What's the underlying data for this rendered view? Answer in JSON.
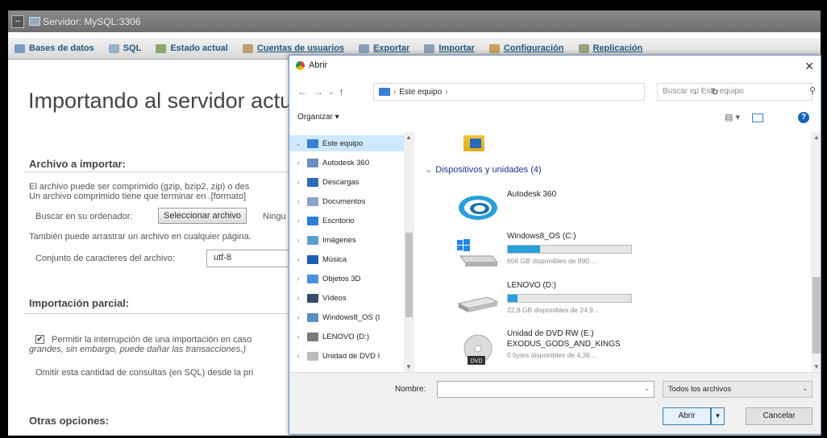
{
  "app": {
    "window_title": "Servidor: MySQL:3306",
    "tabs": [
      {
        "label": "Bases de datos",
        "icon": "databases-icon",
        "color": "#7a9cc4"
      },
      {
        "label": "SQL",
        "icon": "sql-icon",
        "color": "#9ab0c8"
      },
      {
        "label": "Estado actual",
        "icon": "status-icon",
        "color": "#8aa86a"
      },
      {
        "label": "Cuentas de usuarios",
        "icon": "users-icon",
        "color": "#b8a070"
      },
      {
        "label": "Exportar",
        "icon": "export-icon",
        "color": "#8a9fb8"
      },
      {
        "label": "Importar",
        "icon": "import-icon",
        "color": "#8a9fb8"
      },
      {
        "label": "Configuración",
        "icon": "settings-icon",
        "color": "#c7a060"
      },
      {
        "label": "Replicación",
        "icon": "replication-icon",
        "color": "#9aa080"
      }
    ],
    "page_title": "Importando al servidor actua",
    "file_section_title": "Archivo a importar:",
    "compress_line1": "El archivo puede ser comprimido (gzip, bzip2, zip) o des",
    "compress_line2": "Un archivo comprimido tiene que terminar en .[formato]",
    "browse_label": "Buscar en su ordenador:",
    "browse_button": "Seleccionar archivo",
    "no_file": "Ningu",
    "drag_text": "También puede arrastrar un archivo en cualquier página.",
    "charset_label": "Conjunto de caracteres del archivo:",
    "charset_value": "utf-8",
    "partial_title": "Importación parcial:",
    "partial_check": "✔",
    "partial_line1": "Permitir la interrupción de una importación en caso",
    "partial_line2": "grandes, sin embargo, puede dañar las transacciones.)",
    "skip_text": "Omitir esta cantidad de consultas (en SQL) desde la pri",
    "other_title": "Otras opciones:"
  },
  "dialog": {
    "title": "Abrir",
    "close": "✕",
    "nav": {
      "back": "←",
      "forward": "→",
      "recent": "⌄",
      "up": "↑"
    },
    "address": "Este equipo",
    "address_sep": "›",
    "search_placeholder": "Buscar en Este equipo",
    "organize": "Organizar ▾",
    "help": "?",
    "nav_items": [
      {
        "label": "Este equipo",
        "color": "#3a7fd6",
        "chev": "⌄",
        "selected": true,
        "icon": "this-pc-icon"
      },
      {
        "label": "Autodesk 360",
        "color": "#6a8fbf",
        "chev": "›",
        "selected": false,
        "icon": "cloud-icon"
      },
      {
        "label": "Descargas",
        "color": "#2a6bb8",
        "chev": "›",
        "selected": false,
        "icon": "downloads-icon"
      },
      {
        "label": "Documentos",
        "color": "#8aa4c8",
        "chev": "›",
        "selected": false,
        "icon": "documents-icon"
      },
      {
        "label": "Escritorio",
        "color": "#2a7fd6",
        "chev": "›",
        "selected": false,
        "icon": "desktop-icon"
      },
      {
        "label": "Imágenes",
        "color": "#5a9fd0",
        "chev": "›",
        "selected": false,
        "icon": "pictures-icon"
      },
      {
        "label": "Música",
        "color": "#1e5ab0",
        "chev": "›",
        "selected": false,
        "icon": "music-icon"
      },
      {
        "label": "Objetos 3D",
        "color": "#4a90e2",
        "chev": "›",
        "selected": false,
        "icon": "objects3d-icon"
      },
      {
        "label": "Vídeos",
        "color": "#3a4a6a",
        "chev": "›",
        "selected": false,
        "icon": "videos-icon"
      },
      {
        "label": "Windows8_OS (I",
        "color": "#5a8fc0",
        "chev": "›",
        "selected": false,
        "icon": "drive-c-icon"
      },
      {
        "label": "LENOVO (D:)",
        "color": "#7a7a7a",
        "chev": "›",
        "selected": false,
        "icon": "drive-d-icon"
      },
      {
        "label": "Unidad de DVD I",
        "color": "#bbbbbb",
        "chev": "›",
        "selected": false,
        "icon": "dvd-icon"
      }
    ],
    "group_header": "Dispositivos y unidades (4)",
    "devices": [
      {
        "name": "Autodesk 360",
        "name2": "",
        "free": "",
        "usage": null,
        "icon": "autodesk-icon"
      },
      {
        "name": "Windows8_OS (C:)",
        "name2": "",
        "free": "656 GB disponibles de 890 ...",
        "usage": 0.26,
        "icon": "windows-drive-icon"
      },
      {
        "name": "LENOVO (D:)",
        "name2": "",
        "free": "22,8 GB disponibles de 24,9...",
        "usage": 0.08,
        "icon": "hdd-icon"
      },
      {
        "name": "Unidad de DVD RW (E:)",
        "name2": "EXODUS_GODS_AND_KINGS",
        "free": "0 bytes disponibles de 4,36 ...",
        "usage": null,
        "icon": "dvd-disc-icon"
      }
    ],
    "name_label": "Nombre:",
    "type_value": "Todos los archivos",
    "open_button": "Abrir",
    "cancel_button": "Cancelar"
  }
}
